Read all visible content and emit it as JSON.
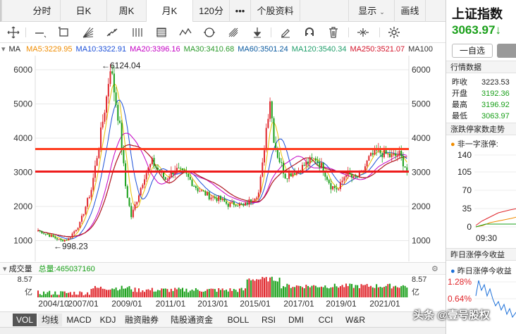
{
  "tabs": [
    {
      "label": "分时"
    },
    {
      "label": "日K"
    },
    {
      "label": "周K"
    },
    {
      "label": "月K"
    },
    {
      "label": "120分"
    },
    {
      "label": "•••"
    },
    {
      "label": "个股资料"
    },
    {
      "label": "显示"
    },
    {
      "label": "画线"
    }
  ],
  "active_tab": "月K",
  "ma": {
    "label": "MA",
    "items": [
      {
        "text": "MA5:3229.95",
        "color": "#f08c00"
      },
      {
        "text": "MA10:3322.91",
        "color": "#1b4fd8"
      },
      {
        "text": "MA20:3396.16",
        "color": "#c400c4"
      },
      {
        "text": "MA30:3410.68",
        "color": "#2a9a2a"
      },
      {
        "text": "MA60:3501.24",
        "color": "#0a5aa0"
      },
      {
        "text": "MA120:3540.34",
        "color": "#1f9e6a"
      },
      {
        "text": "MA250:3521.07",
        "color": "#d4142a"
      },
      {
        "text": "MA100",
        "color": "#333333"
      }
    ]
  },
  "price_axis": {
    "ticks": [
      "6000",
      "5000",
      "4000",
      "3000",
      "2000",
      "1000"
    ]
  },
  "annotations": {
    "high": "←6124.04",
    "low": "←998.23"
  },
  "volume": {
    "label": "成交量",
    "total": "总量:465037160",
    "axis_top": "8.57",
    "axis_unit": "亿"
  },
  "date_axis": [
    "2004/10",
    "2007/01",
    "2009/01",
    "2011/01",
    "2013/01",
    "2015/01",
    "2017/01",
    "2019/01",
    "2021/01"
  ],
  "bottom_tabs": [
    "VOL",
    "均线",
    "MACD",
    "KDJ",
    "融资融券",
    "陆股通资金",
    "BOLL",
    "RSI",
    "DMI",
    "CCI",
    "W&R"
  ],
  "sidebar": {
    "title": "上证指数",
    "price": "3063.97",
    "price_arrow": "↓",
    "watch_button": "一自选",
    "section_quote": "行情数据",
    "quotes": [
      {
        "k": "昨收",
        "v": "3223.53"
      },
      {
        "k": "开盘",
        "v": "3192.36"
      },
      {
        "k": "最高",
        "v": "3196.92"
      },
      {
        "k": "最低",
        "v": "3063.97"
      }
    ],
    "section_updown": "涨跌停家数走势",
    "updown_legend": "非一字涨停:",
    "updown_ticks": [
      "140",
      "105",
      "70",
      "35",
      "0"
    ],
    "updown_time": "09:30",
    "section_yest": "昨日涨停今收益",
    "yest_legend": "昨日涨停今收益",
    "yest_ticks": [
      "1.28%",
      "0.64%"
    ]
  },
  "watermark": "头条 @壹号股权",
  "colors": {
    "up": "#e0262b",
    "down": "#1aa01a",
    "ref_line": "#ff3b1e",
    "grid": "#e8e8e8"
  }
}
